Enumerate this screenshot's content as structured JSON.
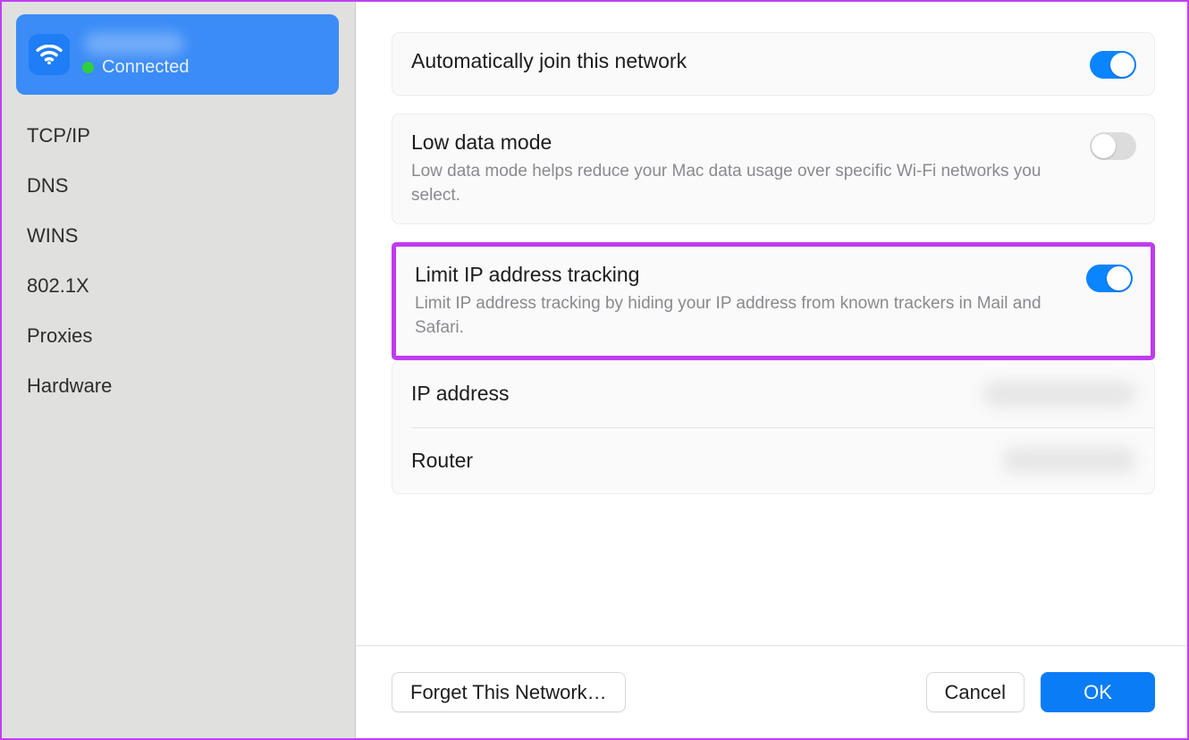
{
  "sidebar": {
    "network": {
      "icon": "wifi-icon",
      "ssid_redacted": true,
      "status_label": "Connected",
      "status_color": "#2fce3f",
      "selected_bg": "#3b8cf7"
    },
    "items": [
      {
        "label": "TCP/IP"
      },
      {
        "label": "DNS"
      },
      {
        "label": "WINS"
      },
      {
        "label": "802.1X"
      },
      {
        "label": "Proxies"
      },
      {
        "label": "Hardware"
      }
    ]
  },
  "main": {
    "auto_join": {
      "title": "Automatically join this network",
      "toggle_state": "on"
    },
    "low_data_mode": {
      "title": "Low data mode",
      "description": "Low data mode helps reduce your Mac data usage over specific Wi-Fi networks you select.",
      "toggle_state": "off"
    },
    "limit_ip_tracking": {
      "title": "Limit IP address tracking",
      "description": "Limit IP address tracking by hiding your IP address from known trackers in Mail and Safari.",
      "toggle_state": "on",
      "highlighted": true,
      "highlight_color": "#c03bf0"
    },
    "info_rows": [
      {
        "label": "IP address",
        "value_redacted": true
      },
      {
        "label": "Router",
        "value_redacted": true
      }
    ]
  },
  "footer": {
    "forget_label": "Forget This Network…",
    "cancel_label": "Cancel",
    "ok_label": "OK",
    "ok_color": "#0a7cf6"
  },
  "colors": {
    "window_border": "#c040f0",
    "sidebar_bg": "#e0e0de",
    "card_bg": "#fafafa",
    "toggle_on": "#0a84ff",
    "toggle_off": "#dcdcdc"
  }
}
